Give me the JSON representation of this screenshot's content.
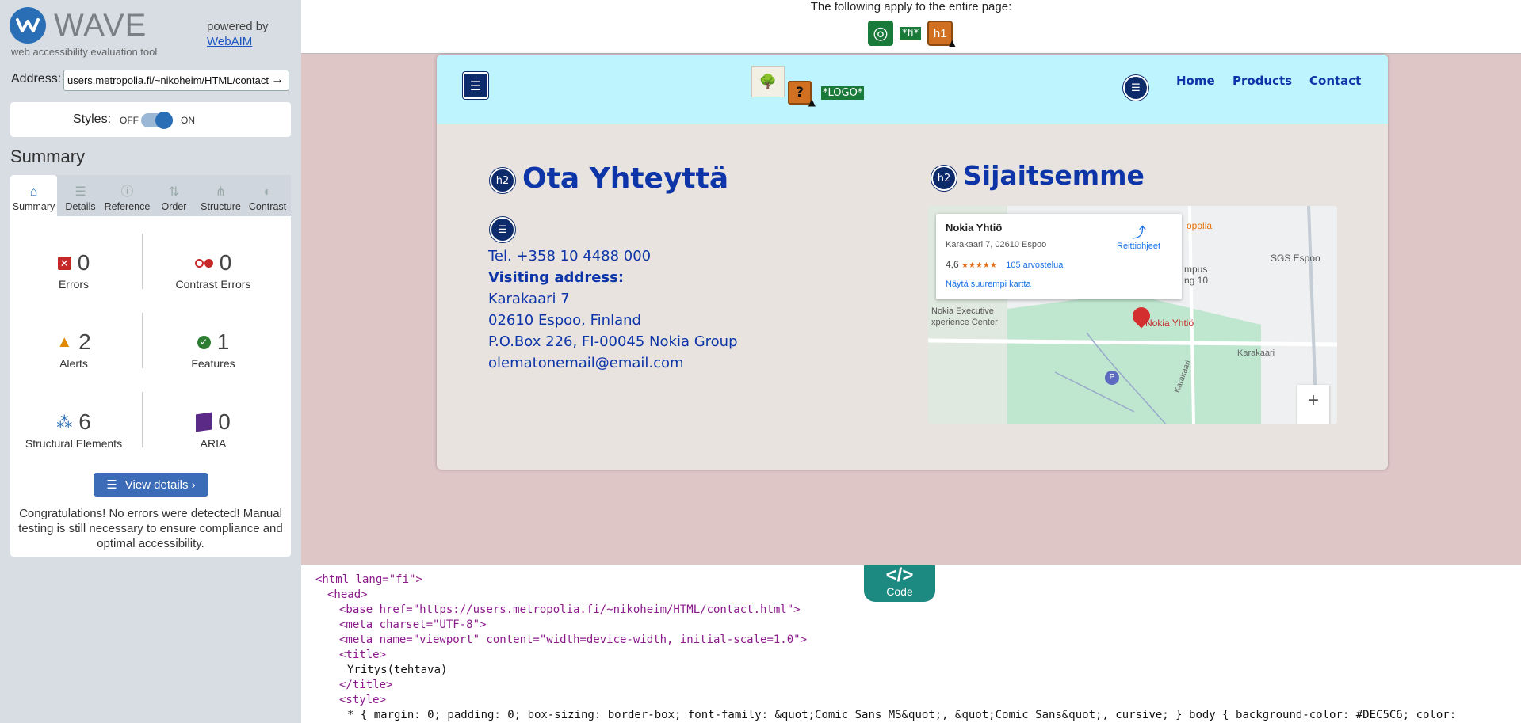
{
  "sidebar": {
    "app_name": "WAVE",
    "tagline": "web accessibility evaluation tool",
    "powered_by": "powered by",
    "powered_by_link": "WebAIM",
    "address_label": "Address:",
    "address_value": "users.metropolia.fi/~nikoheim/HTML/contact",
    "styles_label": "Styles:",
    "styles_off": "OFF",
    "styles_on": "ON",
    "summary_heading": "Summary",
    "tabs": [
      "Summary",
      "Details",
      "Reference",
      "Order",
      "Structure",
      "Contrast"
    ],
    "stats": {
      "errors": {
        "count": "0",
        "label": "Errors"
      },
      "contrast_errors": {
        "count": "0",
        "label": "Contrast Errors"
      },
      "alerts": {
        "count": "2",
        "label": "Alerts"
      },
      "features": {
        "count": "1",
        "label": "Features"
      },
      "structural": {
        "count": "6",
        "label": "Structural Elements"
      },
      "aria": {
        "count": "0",
        "label": "ARIA"
      }
    },
    "view_details": "View details ›",
    "congrats": "Congratulations! No errors were detected! Manual testing is still necessary to ensure compliance and optimal accessibility."
  },
  "page_header": {
    "text": "The following apply to the entire page:",
    "lang_badge": "*fi*",
    "h1_badge": "h1"
  },
  "site": {
    "logo_alt_badge": "*LOGO*",
    "nav": [
      "Home",
      "Products",
      "Contact"
    ],
    "h2_badge": "h2",
    "contact_heading": "Ota Yhteyttä",
    "location_heading": "Sijaitsemme",
    "contact": {
      "tel": "Tel. +358 10 4488 000",
      "visiting": "Visiting address:",
      "street": "Karakaari 7",
      "city": "02610 Espoo, Finland",
      "pobox": "P.O.Box 226, FI-00045 Nokia Group",
      "email": "olematonemail@email.com"
    },
    "map": {
      "place_name": "Nokia Yhtiö",
      "place_address": "Karakaari 7, 02610 Espoo",
      "rating": "4,6",
      "stars": "★★★★★",
      "reviews": "105 arvostelua",
      "directions": "Reittiohjeet",
      "larger_map": "Näytä suurempi kartta",
      "pin_label": "Nokia Yhtiö",
      "labels": [
        "SGS Espoo",
        "Nokia Executive",
        "xperience Center",
        "Karakaari",
        "Karakaari",
        "mpus",
        "ng 10",
        "opolia"
      ],
      "zoom_in": "+"
    }
  },
  "code": {
    "tab_glyph": "</>",
    "tab_label": "Code",
    "lines": [
      "<html lang=\"fi\">",
      "<head>",
      "<base href=\"https://users.metropolia.fi/~nikoheim/HTML/contact.html\">",
      "<meta charset=\"UTF-8\">",
      "<meta name=\"viewport\" content=\"width=device-width, initial-scale=1.0\">",
      "<title>",
      "Yritys(tehtava)",
      "</title>",
      "<style>",
      "* { margin: 0; padding: 0; box-sizing: border-box; font-family: &quot;Comic Sans MS&quot;, &quot;Comic Sans&quot;, cursive; } body { background-color: #DEC5C6; color:"
    ]
  }
}
